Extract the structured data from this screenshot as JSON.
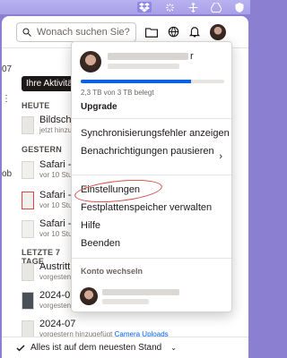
{
  "menubar": {
    "icons": [
      "dropbox-icon",
      "sync-icon",
      "move-icon",
      "drive-icon",
      "shield-icon"
    ]
  },
  "topbar": {
    "search_placeholder": "Wonach suchen Sie?",
    "icons": [
      "folder-icon",
      "globe-icon",
      "bell-icon"
    ]
  },
  "left": {
    "date_partial": "07",
    "activity_button": "Ihre Aktivität",
    "sections": {
      "today": "HEUTE",
      "yesterday": "GESTERN",
      "last7": "LETZTE 7 TAGE"
    },
    "items": [
      {
        "title": "Bildschi",
        "subtitle": "jetzt hinzu"
      },
      {
        "title": "Safari -",
        "subtitle": "vor 10 Stu"
      },
      {
        "title": "Safari -",
        "subtitle": "vor 10 Stu"
      },
      {
        "title": "Safari -",
        "subtitle": "vor 10 Stu"
      },
      {
        "title": "Austritt",
        "subtitle": "vorgesten"
      },
      {
        "title": "2024-07",
        "subtitle": "vorgesten"
      },
      {
        "title": "2024-07",
        "subtitle": "vorgestern hinzugefügt",
        "link": "Camera Uploads"
      }
    ],
    "edge_glyphs": {
      "pager": "⋮",
      "ob": "ob"
    }
  },
  "status": {
    "text": "Alles ist auf dem neuesten Stand",
    "chevron": "⌄"
  },
  "menu": {
    "account_name_suffix": "r",
    "storage_used_fraction": 0.77,
    "storage_text": "2,3 TB von 3 TB belegt",
    "upgrade": "Upgrade",
    "items_group1": [
      "Synchronisierungsfehler anzeigen",
      "Benachrichtigungen pausieren"
    ],
    "items_group2": [
      "Einstellungen",
      "Festplattenspeicher verwalten",
      "Hilfe",
      "Beenden"
    ],
    "switch_account": "Konto wechseln"
  }
}
